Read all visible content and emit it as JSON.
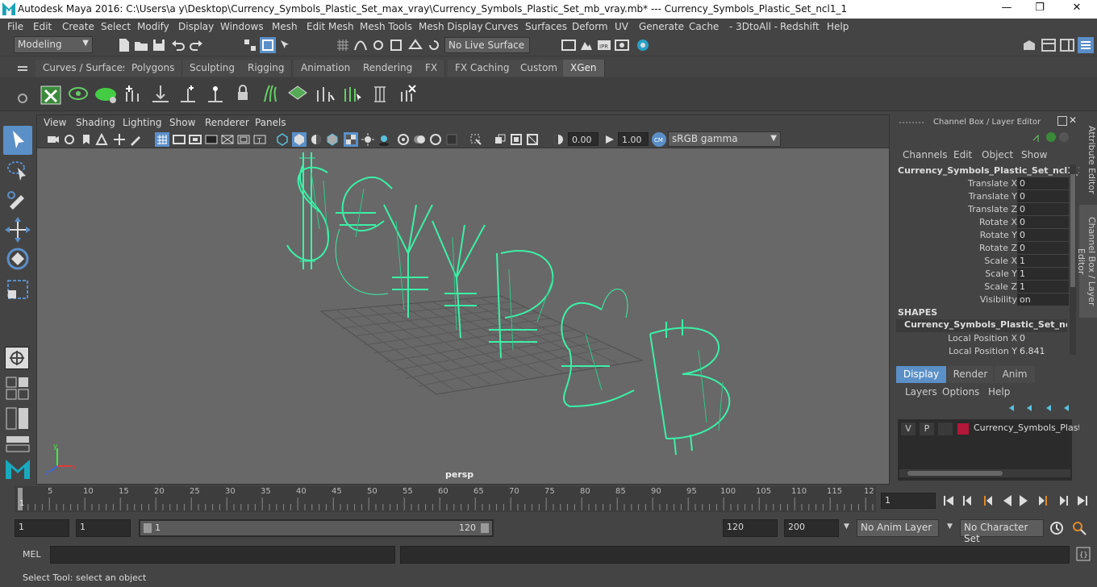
{
  "titlebar": {
    "title": "Autodesk Maya 2016: C:\\Users\\a y\\Desktop\\Currency_Symbols_Plastic_Set_max_vray\\Currency_Symbols_Plastic_Set_mb_vray.mb*   ---   Currency_Symbols_Plastic_Set_ncl1_1",
    "minimize": "—",
    "restore": "❐",
    "close": "✕"
  },
  "menubar": [
    "File",
    "Edit",
    "Create",
    "Select",
    "Modify",
    "Display",
    "Windows",
    "Mesh",
    "Edit Mesh",
    "Mesh Tools",
    "Mesh Display",
    "Curves",
    "Surfaces",
    "Deform",
    "UV",
    "Generate",
    "Cache",
    "- 3DtoAll -",
    "Redshift",
    "Help"
  ],
  "statusline": {
    "mode": "Modeling",
    "live_surface": "No Live Surface"
  },
  "shelf_tabs": [
    "Curves / Surfaces",
    "Polygons",
    "Sculpting",
    "Rigging",
    "Animation",
    "Rendering",
    "FX",
    "FX Caching",
    "Custom",
    "XGen"
  ],
  "active_shelf": "XGen",
  "viewport": {
    "menu": [
      "View",
      "Shading",
      "Lighting",
      "Show",
      "Renderer",
      "Panels"
    ],
    "exposure": "0.00",
    "gamma": "1.00",
    "colorspace": "sRGB gamma",
    "camera": "persp",
    "colors": {
      "wire": "#3cf0a8",
      "grid": "#5a5a5a",
      "bg": "#686868"
    }
  },
  "channelbox": {
    "header": "Channel Box / Layer Editor",
    "menu": [
      "Channels",
      "Edit",
      "Object",
      "Show"
    ],
    "object": "Currency_Symbols_Plastic_Set_ncl1_1",
    "attributes": [
      {
        "name": "Translate X",
        "value": "0"
      },
      {
        "name": "Translate Y",
        "value": "0"
      },
      {
        "name": "Translate Z",
        "value": "0"
      },
      {
        "name": "Rotate X",
        "value": "0"
      },
      {
        "name": "Rotate Y",
        "value": "0"
      },
      {
        "name": "Rotate Z",
        "value": "0"
      },
      {
        "name": "Scale X",
        "value": "1"
      },
      {
        "name": "Scale Y",
        "value": "1"
      },
      {
        "name": "Scale Z",
        "value": "1"
      },
      {
        "name": "Visibility",
        "value": "on"
      }
    ],
    "shapes_header": "SHAPES",
    "shape_name": "Currency_Symbols_Plastic_Set_ncl1...",
    "shape_attrs": [
      {
        "name": "Local Position X",
        "value": "0"
      },
      {
        "name": "Local Position Y",
        "value": "6.841"
      }
    ],
    "layer_tabs": [
      "Display",
      "Render",
      "Anim"
    ],
    "active_layer_tab": "Display",
    "layer_menu": [
      "Layers",
      "Options",
      "Help"
    ],
    "layer": {
      "v": "V",
      "p": "P",
      "name": "Currency_Symbols_Plasti",
      "color": "#b3173a"
    }
  },
  "sidetabs": [
    "Attribute Editor",
    "Channel Box / Layer Editor"
  ],
  "timeline": {
    "ticks": [
      "5",
      "10",
      "15",
      "20",
      "25",
      "30",
      "35",
      "40",
      "45",
      "50",
      "55",
      "60",
      "65",
      "70",
      "75",
      "80",
      "85",
      "90",
      "95",
      "100",
      "105",
      "110",
      "115",
      "12"
    ],
    "current_frame": "1",
    "frame_field": "1"
  },
  "range": {
    "start": "1",
    "playback_start": "1",
    "slider_start": "1",
    "slider_end": "120",
    "end": "120",
    "anim_end": "200",
    "anim_layer": "No Anim Layer",
    "character_set": "No Character Set"
  },
  "mel": {
    "label": "MEL"
  },
  "helpline": "Select Tool: select an object"
}
